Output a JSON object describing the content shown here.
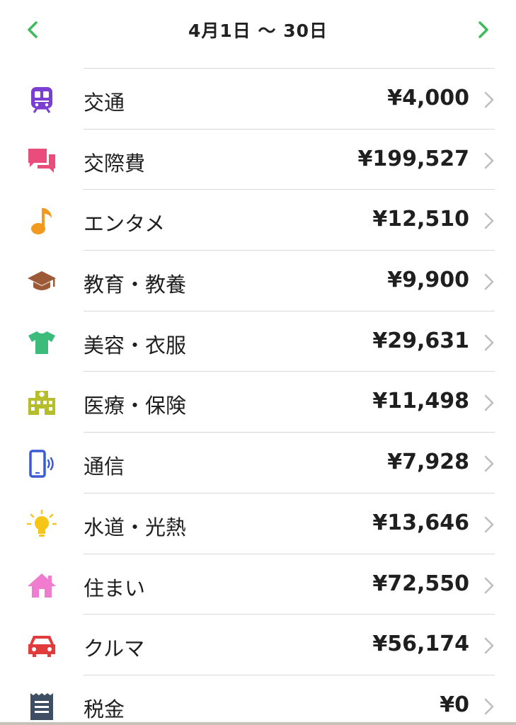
{
  "header": {
    "title": "4月1日 〜 30日",
    "accent_color": "#3dbb5a"
  },
  "categories": [
    {
      "label": "交通",
      "amount": "¥4,000",
      "icon": "train-icon",
      "color": "#7a3fd1"
    },
    {
      "label": "交際費",
      "amount": "¥199,527",
      "icon": "chat-icon",
      "color": "#ea4d7b"
    },
    {
      "label": "エンタメ",
      "amount": "¥12,510",
      "icon": "music-note-icon",
      "color": "#f29a1f"
    },
    {
      "label": "教育・教養",
      "amount": "¥9,900",
      "icon": "graduation-cap-icon",
      "color": "#9c5a36"
    },
    {
      "label": "美容・衣服",
      "amount": "¥29,631",
      "icon": "tshirt-icon",
      "color": "#3dbb7a"
    },
    {
      "label": "医療・保険",
      "amount": "¥11,498",
      "icon": "hospital-icon",
      "color": "#b5bd2b"
    },
    {
      "label": "通信",
      "amount": "¥7,928",
      "icon": "phone-icon",
      "color": "#3b5bd6"
    },
    {
      "label": "水道・光熱",
      "amount": "¥13,646",
      "icon": "lightbulb-icon",
      "color": "#f5c518"
    },
    {
      "label": "住まい",
      "amount": "¥72,550",
      "icon": "house-icon",
      "color": "#ef7ccf"
    },
    {
      "label": "クルマ",
      "amount": "¥56,174",
      "icon": "car-icon",
      "color": "#e23b3b"
    },
    {
      "label": "税金",
      "amount": "¥0",
      "icon": "receipt-icon",
      "color": "#3f4f63"
    }
  ]
}
